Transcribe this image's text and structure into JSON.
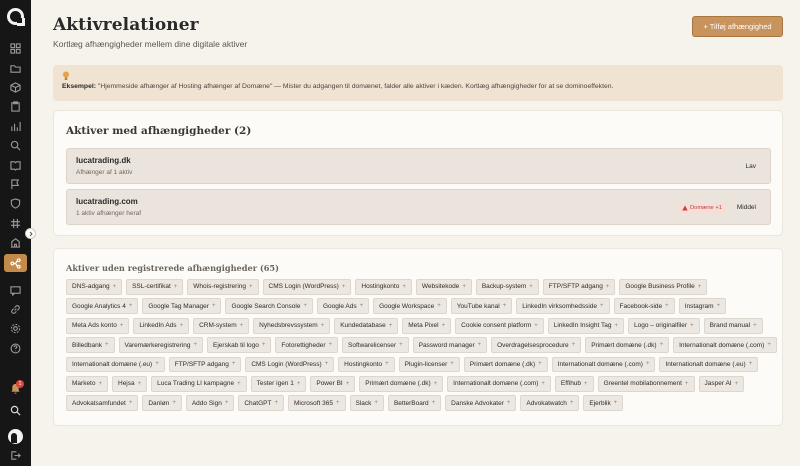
{
  "header": {
    "title": "Aktivrelationer",
    "subtitle": "Kortlæg afhængigheder mellem dine digitale aktiver",
    "add_button_label": "+ Tilføj afhængighed"
  },
  "example": {
    "label": "Eksempel:",
    "text": "\"Hjemmeside afhænger af Hosting afhænger af Domæne\" — Mister du adgangen til domænet, falder alle aktiver i kæden. Kortlæg afhængigheder for at se dominoeffekten."
  },
  "with_dependencies": {
    "title": "Aktiver med afhængigheder (2)",
    "items": [
      {
        "name": "lucatrading.dk",
        "subtitle": "Afhænger af 1 aktiv",
        "badge": "",
        "action": "Lav"
      },
      {
        "name": "lucatrading.com",
        "subtitle": "1 aktiv afhænger heraf",
        "badge": "Domæne +1",
        "action": "Middel"
      }
    ]
  },
  "without_dependencies": {
    "title": "Aktiver uden registrerede afhængigheder (65)",
    "chips": [
      "DNS-adgang",
      "SSL-certifikat",
      "Whois-registrering",
      "CMS Login (WordPress)",
      "Hostingkonto",
      "Websitekode",
      "Backup-system",
      "FTP/SFTP adgang",
      "Google Business Profile",
      "Google Analytics 4",
      "Google Tag Manager",
      "Google Search Console",
      "Google Ads",
      "Google Workspace",
      "YouTube kanal",
      "LinkedIn virksomhedsside",
      "Facebook-side",
      "Instagram",
      "Meta Ads konto",
      "LinkedIn Ads",
      "CRM-system",
      "Nyhedsbrevssystem",
      "Kundedatabase",
      "Meta Pixel",
      "Cookie consent platform",
      "LinkedIn Insight Tag",
      "Logo – originalfiler",
      "Brand manual",
      "Billedbank",
      "Varemærkeregistrering",
      "Ejerskab til logo",
      "Fotorettigheder",
      "Softwarelicenser",
      "Password manager",
      "Overdragelsesprocedure",
      "Primært domæne (.dk)",
      "Internationalt domæne (.com)",
      "Internationalt domæne (.eu)",
      "FTP/SFTP adgang",
      "CMS Login (WordPress)",
      "Hostingkonto",
      "Plugin-licenser",
      "Primært domæne (.dk)",
      "Internationalt domæne (.com)",
      "Internationalt domæne (.eu)",
      "Marketo",
      "Hejsa",
      "Luca Trading LI kampagne",
      "Tester igen 1",
      "Power BI",
      "Primært domæne (.dk)",
      "Internationalt domæne (.com)",
      "Effihub",
      "Greentel mobilabonnement",
      "Jasper AI",
      "Advokatsamfundet",
      "Danløn",
      "Addo Sign",
      "ChatGPT",
      "Microsoft 365",
      "Slack",
      "BetterBoard",
      "Danske Advokater",
      "Advokatwatch",
      "Ejerblik"
    ]
  },
  "sidebar": {
    "notification_count": "1"
  },
  "colors": {
    "accent": "#c8935c",
    "sidebar_bg": "#161616",
    "danger": "#c0443c"
  }
}
